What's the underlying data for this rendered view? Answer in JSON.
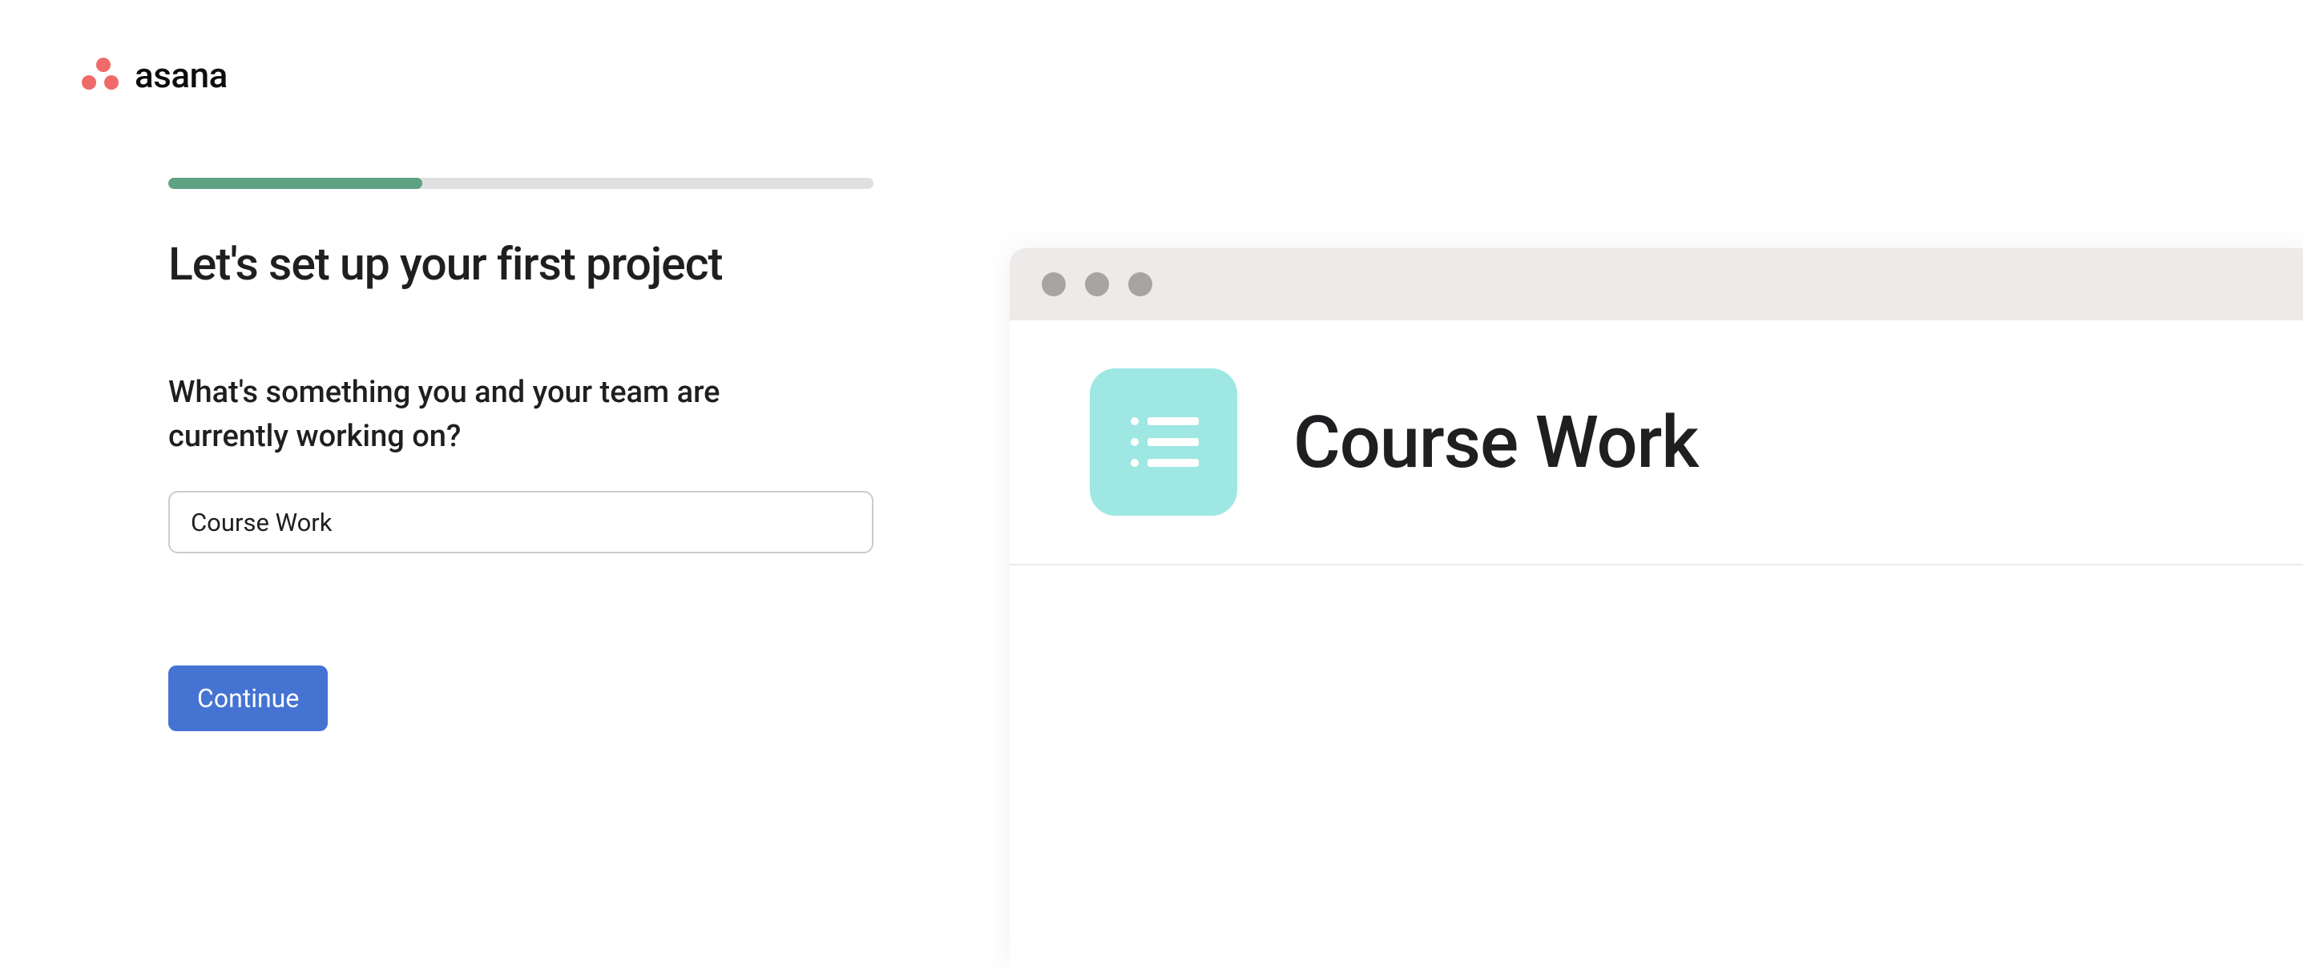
{
  "brand": {
    "name": "asana"
  },
  "onboarding": {
    "progress_percent": 36,
    "title": "Let's set up your first project",
    "prompt": "What's something you and your team are currently working on?",
    "project_name_value": "Course Work",
    "continue_label": "Continue"
  },
  "preview": {
    "project_title": "Course Work",
    "icon_name": "list-icon",
    "icon_bg_color": "#9ee7e3"
  }
}
